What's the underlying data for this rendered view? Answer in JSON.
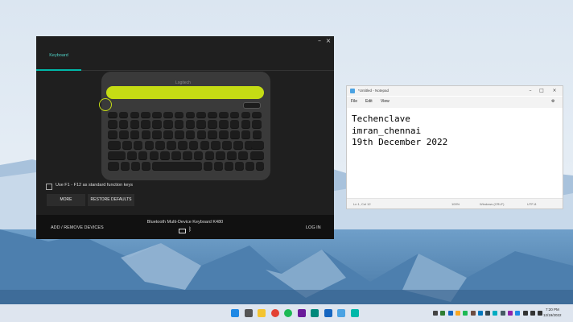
{
  "logitech": {
    "tab_keyboard": "Keyboard",
    "brand_logo": "Logitech",
    "fn_keys_label": "Use F1 - F12 as standard function keys",
    "more_button": "MORE",
    "restore_button": "RESTORE DEFAULTS",
    "add_remove_devices": "ADD / REMOVE DEVICES",
    "device_name": "Bluetooth Multi-Device Keyboard K480",
    "log_in": "LOG IN",
    "minimize_glyph": "–",
    "close_glyph": "×",
    "bluetooth_glyph": "ᛒ",
    "accent_color": "#00b8a9",
    "cradle_color": "#c5dc14"
  },
  "notepad": {
    "title": "*Untitled - Notepad",
    "menu": [
      "File",
      "Edit",
      "View"
    ],
    "content": "Techenclave\nimran_chennai\n19th December 2022",
    "status": {
      "position": "Ln 1, Col 12",
      "zoom": "100%",
      "line_ending": "Windows (CRLF)",
      "encoding": "UTF-8"
    },
    "minimize_glyph": "–",
    "maximize_glyph": "□",
    "close_glyph": "×",
    "gear_glyph": "⚙"
  },
  "taskbar": {
    "apps": [
      {
        "name": "start-icon",
        "color": "#1e88e5"
      },
      {
        "name": "search-icon",
        "color": "#555555"
      },
      {
        "name": "file-explorer-icon",
        "color": "#f4c430"
      },
      {
        "name": "chrome-icon",
        "color": "#e34133"
      },
      {
        "name": "spotify-icon",
        "color": "#1db954"
      },
      {
        "name": "app-icon",
        "color": "#6a1b9a"
      },
      {
        "name": "app-icon",
        "color": "#00897b"
      },
      {
        "name": "app-icon",
        "color": "#1565c0"
      },
      {
        "name": "notepad-icon",
        "color": "#4ba3e3"
      },
      {
        "name": "logitech-options-icon",
        "color": "#00b8a9"
      }
    ],
    "tray": [
      {
        "name": "chevron-up-icon",
        "color": "#444444"
      },
      {
        "name": "tray-app-icon",
        "color": "#2e7d32"
      },
      {
        "name": "tray-app-icon",
        "color": "#1565c0"
      },
      {
        "name": "tray-app-icon",
        "color": "#f9a825"
      },
      {
        "name": "tray-app-icon",
        "color": "#1db954"
      },
      {
        "name": "tray-app-icon",
        "color": "#6d4c41"
      },
      {
        "name": "tray-app-icon",
        "color": "#0277bd"
      },
      {
        "name": "tray-app-icon",
        "color": "#37474f"
      },
      {
        "name": "tray-app-icon",
        "color": "#00acc1"
      },
      {
        "name": "tray-app-icon",
        "color": "#455a64"
      },
      {
        "name": "tray-app-icon",
        "color": "#8e24aa"
      },
      {
        "name": "bluetooth-icon",
        "color": "#1e88e5"
      },
      {
        "name": "wifi-icon",
        "color": "#333333"
      },
      {
        "name": "volume-icon",
        "color": "#333333"
      },
      {
        "name": "battery-icon",
        "color": "#333333"
      }
    ],
    "time": "7:20 PM",
    "date": "12/19/2022"
  }
}
